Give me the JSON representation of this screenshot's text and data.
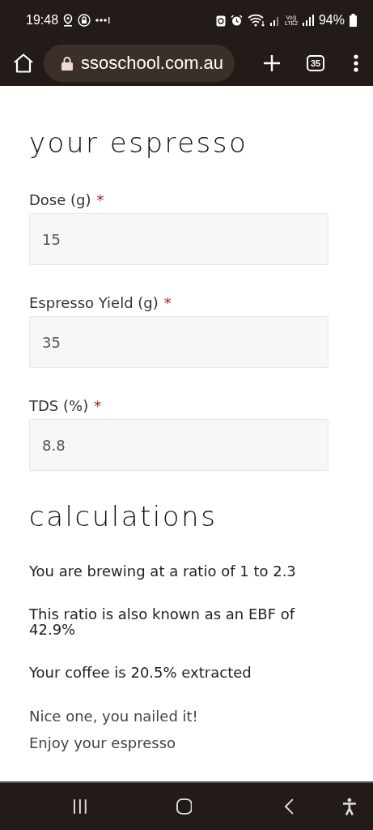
{
  "status_bar": {
    "time": "19:48",
    "network": "Vo)) LTE2",
    "battery": "94%"
  },
  "browser": {
    "url": "ssoschool.com.au",
    "tab_count": "35"
  },
  "form": {
    "heading": "your espresso",
    "fields": [
      {
        "label": "Dose (g)",
        "required_mark": "*",
        "value": "15"
      },
      {
        "label": "Espresso Yield (g)",
        "required_mark": "*",
        "value": "35"
      },
      {
        "label": "TDS (%)",
        "required_mark": "*",
        "value": "8.8"
      }
    ]
  },
  "calculations": {
    "heading": "calculations",
    "results": [
      "You are brewing at a ratio of 1 to 2.3",
      "This ratio is also known as an EBF of 42.9%",
      "Your coffee is 20.5% extracted"
    ],
    "messages": [
      "Nice one, you nailed it!",
      "Enjoy your espresso"
    ]
  }
}
